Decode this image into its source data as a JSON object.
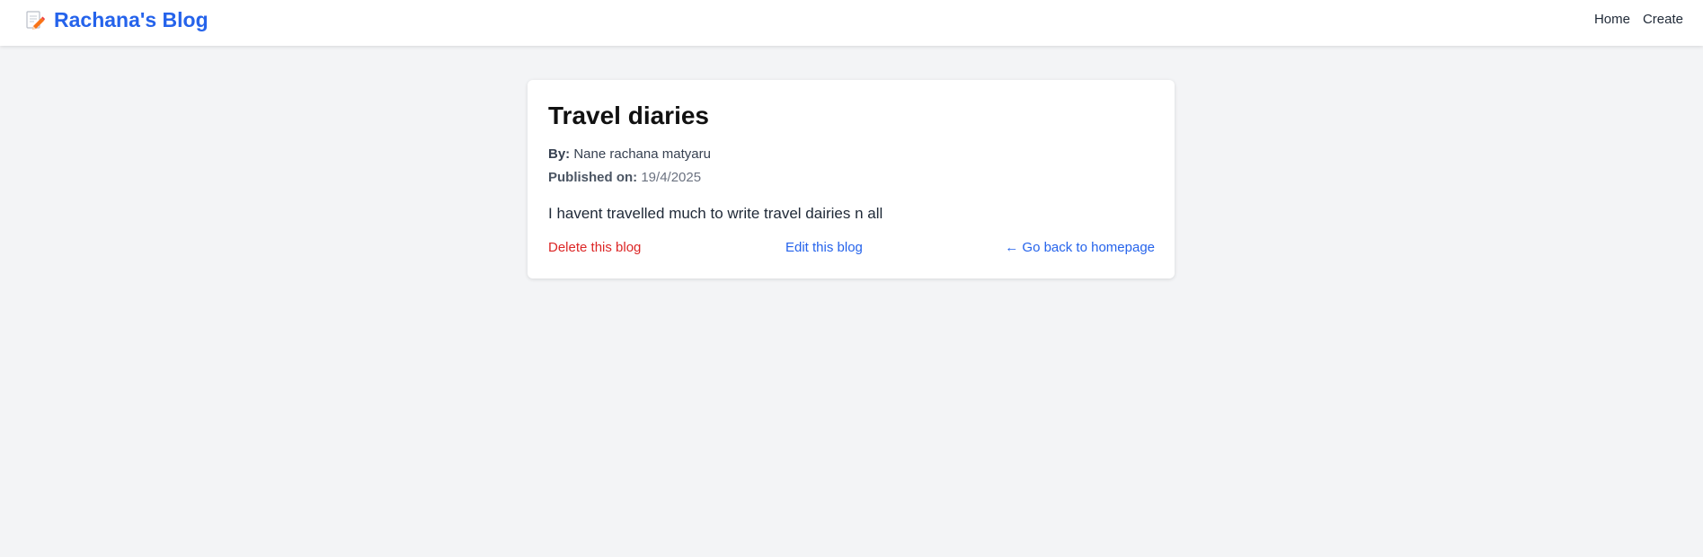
{
  "nav": {
    "brand_title": "Rachana's Blog",
    "brand_icon": "memo-pencil-icon",
    "links": [
      {
        "label": "Home"
      },
      {
        "label": "Create"
      }
    ],
    "brand_color": "#2563eb"
  },
  "post": {
    "title": "Travel diaries",
    "author_label": "By:",
    "author": "Nane rachana matyaru",
    "published_label": "Published on:",
    "published_date": "19/4/2025",
    "body": "I havent travelled much to write travel dairies n all"
  },
  "actions": {
    "delete_label": "Delete this blog",
    "edit_label": "Edit this blog",
    "back_label": "← Go back to homepage",
    "delete_color": "#dc2626",
    "link_color": "#2563eb"
  }
}
